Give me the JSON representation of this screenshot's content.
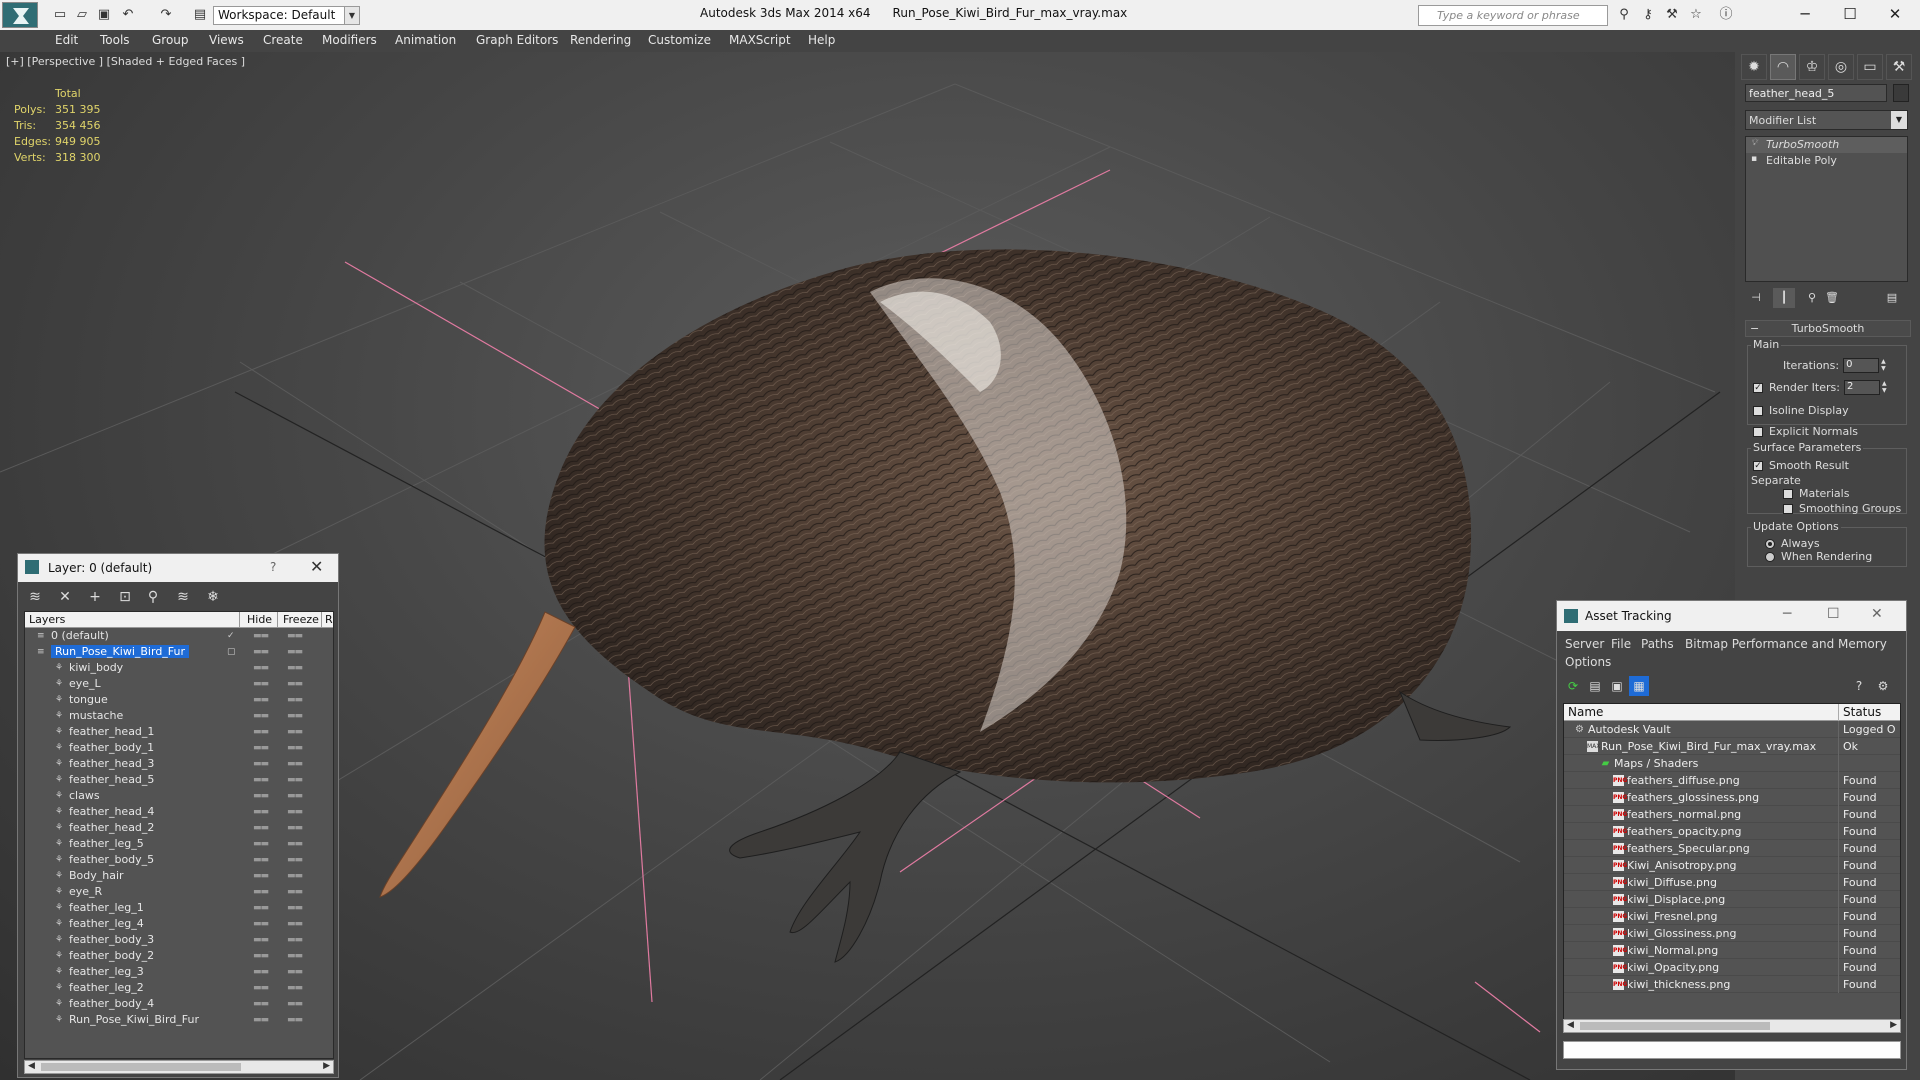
{
  "titlebar": {
    "workspace": "Workspace: Default",
    "app_name": "Autodesk 3ds Max  2014 x64",
    "file_name": "Run_Pose_Kiwi_Bird_Fur_max_vray.max",
    "search_placeholder": "Type a keyword or phrase"
  },
  "menu": [
    "Edit",
    "Tools",
    "Group",
    "Views",
    "Create",
    "Modifiers",
    "Animation",
    "Graph Editors",
    "Rendering",
    "Customize",
    "MAXScript",
    "Help"
  ],
  "viewport": {
    "label": "[+] [Perspective ] [Shaded + Edged Faces ]",
    "stats": {
      "header": "Total",
      "rows": [
        {
          "label": "Polys:",
          "value": "351 395"
        },
        {
          "label": "Tris:",
          "value": "354 456"
        },
        {
          "label": "Edges:",
          "value": "949 905"
        },
        {
          "label": "Verts:",
          "value": "318 300"
        }
      ]
    }
  },
  "command_panel": {
    "object_name": "feather_head_5",
    "modifier_list": "Modifier List",
    "stack": [
      {
        "label": "TurboSmooth",
        "selected": true
      },
      {
        "label": "Editable Poly",
        "selected": false
      }
    ],
    "rollout_title": "TurboSmooth",
    "main_group": "Main",
    "iterations_label": "Iterations:",
    "iterations_value": "0",
    "render_iters_label": "Render Iters:",
    "render_iters_value": "2",
    "isoline_label": "Isoline Display",
    "explicit_normals_label": "Explicit Normals",
    "surface_group": "Surface Parameters",
    "smooth_result_label": "Smooth Result",
    "separate_label": "Separate",
    "materials_label": "Materials",
    "smoothing_groups_label": "Smoothing Groups",
    "update_group": "Update Options",
    "always_label": "Always",
    "when_rendering_label": "When Rendering"
  },
  "layer_dialog": {
    "title": "Layer: 0 (default)",
    "help": "?",
    "columns": {
      "layers": "Layers",
      "hide": "Hide",
      "freeze": "Freeze",
      "r": "R"
    },
    "rows": [
      {
        "name": "0 (default)",
        "level": 0,
        "type": "layer",
        "checked": true
      },
      {
        "name": "Run_Pose_Kiwi_Bird_Fur",
        "level": 0,
        "type": "layer",
        "selected": true
      },
      {
        "name": "kiwi_body",
        "level": 1,
        "type": "object"
      },
      {
        "name": "eye_L",
        "level": 1,
        "type": "object"
      },
      {
        "name": "tongue",
        "level": 1,
        "type": "object"
      },
      {
        "name": "mustache",
        "level": 1,
        "type": "object"
      },
      {
        "name": "feather_head_1",
        "level": 1,
        "type": "object"
      },
      {
        "name": "feather_body_1",
        "level": 1,
        "type": "object"
      },
      {
        "name": "feather_head_3",
        "level": 1,
        "type": "object"
      },
      {
        "name": "feather_head_5",
        "level": 1,
        "type": "object"
      },
      {
        "name": "claws",
        "level": 1,
        "type": "object"
      },
      {
        "name": "feather_head_4",
        "level": 1,
        "type": "object"
      },
      {
        "name": "feather_head_2",
        "level": 1,
        "type": "object"
      },
      {
        "name": "feather_leg_5",
        "level": 1,
        "type": "object"
      },
      {
        "name": "feather_body_5",
        "level": 1,
        "type": "object"
      },
      {
        "name": "Body_hair",
        "level": 1,
        "type": "object"
      },
      {
        "name": "eye_R",
        "level": 1,
        "type": "object"
      },
      {
        "name": "feather_leg_1",
        "level": 1,
        "type": "object"
      },
      {
        "name": "feather_leg_4",
        "level": 1,
        "type": "object"
      },
      {
        "name": "feather_body_3",
        "level": 1,
        "type": "object"
      },
      {
        "name": "feather_body_2",
        "level": 1,
        "type": "object"
      },
      {
        "name": "feather_leg_3",
        "level": 1,
        "type": "object"
      },
      {
        "name": "feather_leg_2",
        "level": 1,
        "type": "object"
      },
      {
        "name": "feather_body_4",
        "level": 1,
        "type": "object"
      },
      {
        "name": "Run_Pose_Kiwi_Bird_Fur",
        "level": 1,
        "type": "object"
      }
    ]
  },
  "asset_dialog": {
    "title": "Asset Tracking",
    "menu": [
      "Server",
      "File",
      "Paths",
      "Bitmap Performance and Memory",
      "Options"
    ],
    "columns": {
      "name": "Name",
      "status": "Status"
    },
    "rows": [
      {
        "name": "Autodesk Vault",
        "status": "Logged O",
        "level": 0,
        "icon": "vault"
      },
      {
        "name": "Run_Pose_Kiwi_Bird_Fur_max_vray.max",
        "status": "Ok",
        "level": 1,
        "icon": "max"
      },
      {
        "name": "Maps / Shaders",
        "status": "",
        "level": 2,
        "icon": "maps"
      },
      {
        "name": "feathers_diffuse.png",
        "status": "Found",
        "level": 3,
        "icon": "png"
      },
      {
        "name": "feathers_glossiness.png",
        "status": "Found",
        "level": 3,
        "icon": "png"
      },
      {
        "name": "feathers_normal.png",
        "status": "Found",
        "level": 3,
        "icon": "png"
      },
      {
        "name": "feathers_opacity.png",
        "status": "Found",
        "level": 3,
        "icon": "png"
      },
      {
        "name": "feathers_Specular.png",
        "status": "Found",
        "level": 3,
        "icon": "png"
      },
      {
        "name": "Kiwi_Anisotropy.png",
        "status": "Found",
        "level": 3,
        "icon": "png"
      },
      {
        "name": "kiwi_Diffuse.png",
        "status": "Found",
        "level": 3,
        "icon": "png"
      },
      {
        "name": "kiwi_Displace.png",
        "status": "Found",
        "level": 3,
        "icon": "png"
      },
      {
        "name": "kiwi_Fresnel.png",
        "status": "Found",
        "level": 3,
        "icon": "png"
      },
      {
        "name": "kiwi_Glossiness.png",
        "status": "Found",
        "level": 3,
        "icon": "png"
      },
      {
        "name": "kiwi_Normal.png",
        "status": "Found",
        "level": 3,
        "icon": "png"
      },
      {
        "name": "kiwi_Opacity.png",
        "status": "Found",
        "level": 3,
        "icon": "png"
      },
      {
        "name": "kiwi_thickness.png",
        "status": "Found",
        "level": 3,
        "icon": "png"
      }
    ]
  }
}
